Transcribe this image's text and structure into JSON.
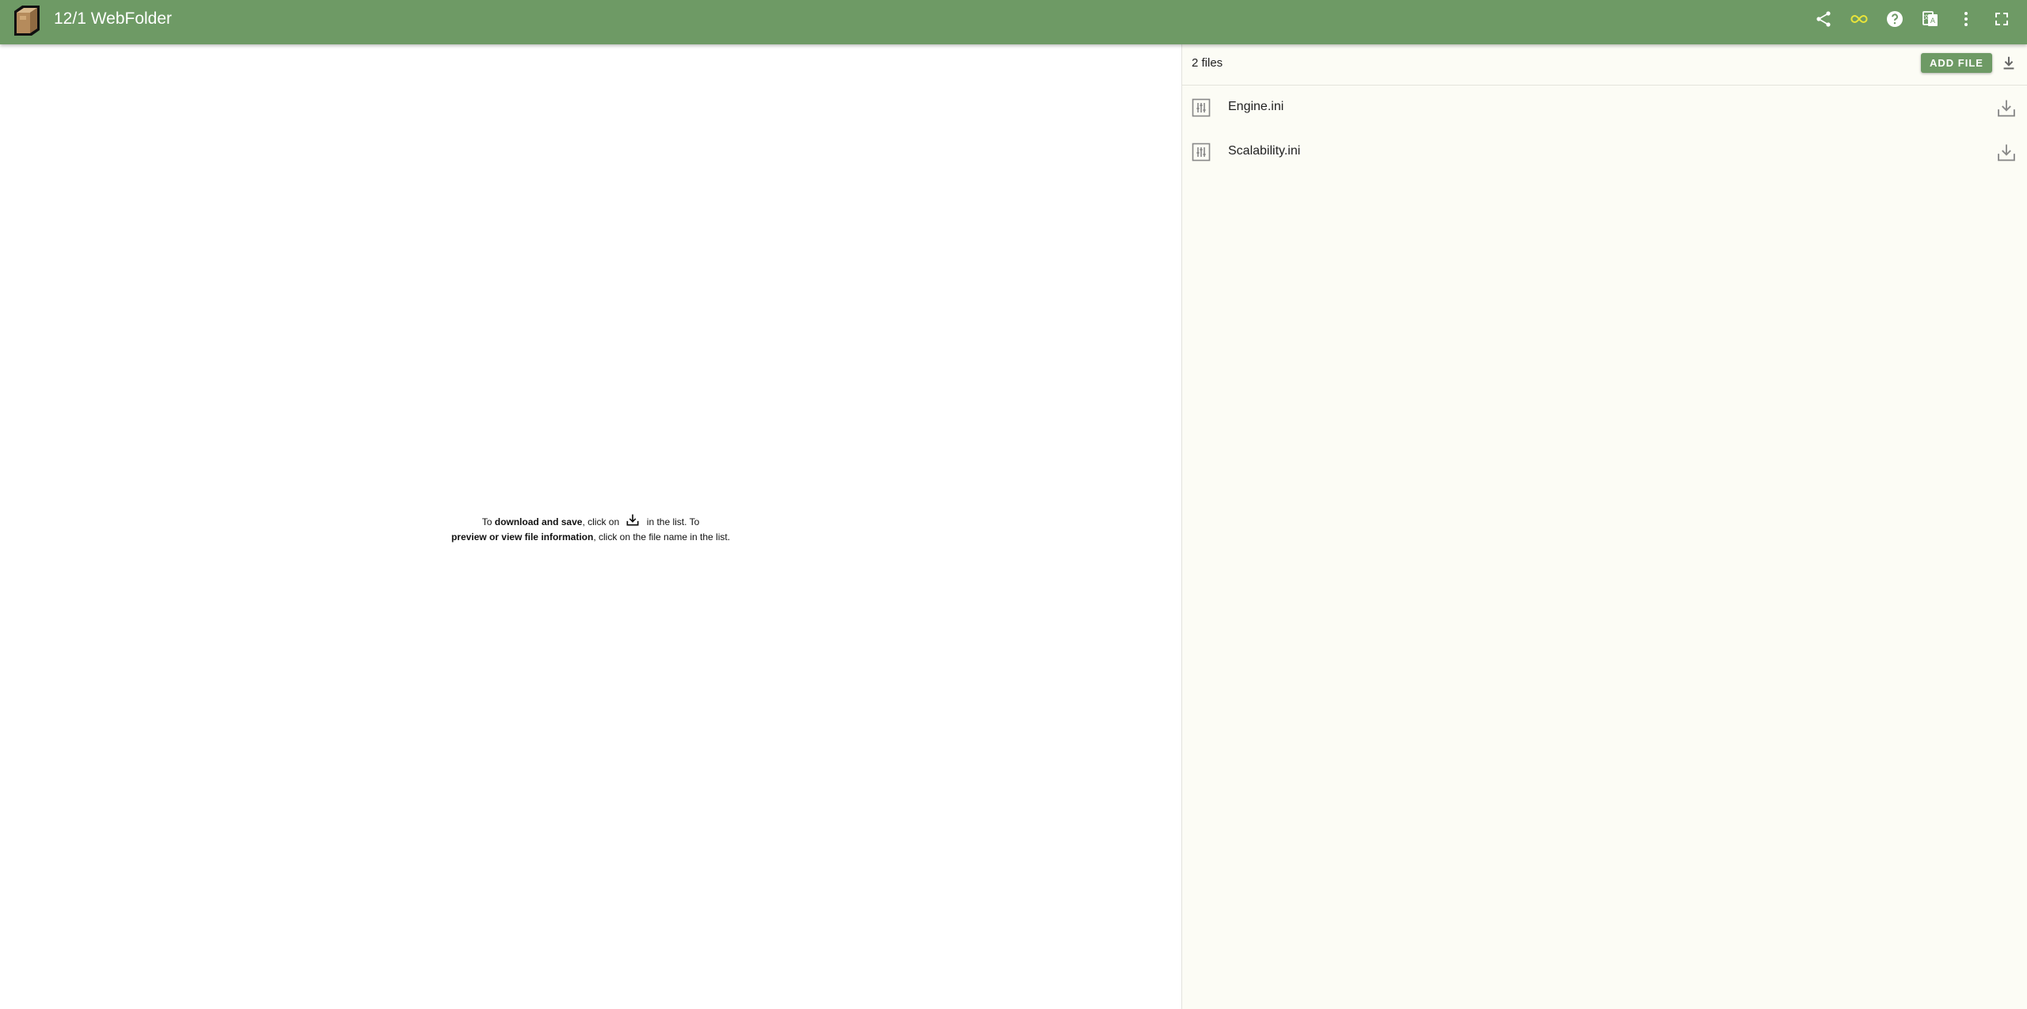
{
  "app": {
    "title": "12/1 WebFolder"
  },
  "toolbar": {
    "icons": [
      "share-icon",
      "infinity-icon",
      "help-icon",
      "translate-icon",
      "more-vert-icon",
      "fullscreen-icon"
    ]
  },
  "preview": {
    "hint": {
      "line1_prefix": "To ",
      "line1_bold": "download and save",
      "line1_mid": ", click on ",
      "line1_suffix": " in the list. To",
      "line2_bold": "preview or view file information",
      "line2_suffix": ", click on the file name in the list."
    }
  },
  "files_panel": {
    "count_label": "2 files",
    "add_button_label": "ADD FILE",
    "files": [
      {
        "name": "Engine.ini",
        "icon": "settings-file-icon"
      },
      {
        "name": "Scalability.ini",
        "icon": "settings-file-icon"
      }
    ]
  },
  "colors": {
    "brand": "#6e9a65",
    "accent": "#e8e43a",
    "panel_bg": "#fcfcf5"
  }
}
